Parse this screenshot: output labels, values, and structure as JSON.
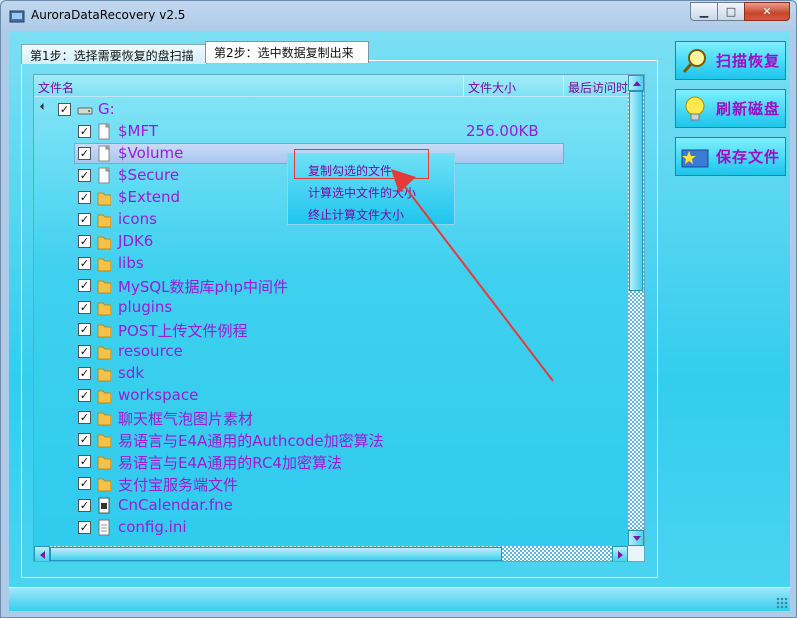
{
  "window": {
    "title": "AuroraDataRecovery v2.5",
    "min_glyph": "▁",
    "max_glyph": "□",
    "close_glyph": "✕"
  },
  "tabs": [
    {
      "label": "第1步：选择需要恢复的盘扫描",
      "active": false
    },
    {
      "label": "第2步：选中数据复制出来",
      "active": true
    }
  ],
  "list": {
    "columns": [
      "文件名",
      "文件大小",
      "最后访问时间"
    ],
    "root": {
      "label": "G:",
      "checked": true,
      "icon": "drive-icon"
    },
    "rows": [
      {
        "name": "$MFT",
        "size": "256.00KB",
        "icon": "file-icon",
        "checked": true
      },
      {
        "name": "$Volume",
        "size": "",
        "icon": "file-icon",
        "checked": true,
        "selected": true
      },
      {
        "name": "$Secure",
        "size": "",
        "icon": "file-icon",
        "checked": true
      },
      {
        "name": "$Extend",
        "size": "",
        "icon": "folder-icon",
        "checked": true
      },
      {
        "name": "icons",
        "size": "",
        "icon": "folder-icon",
        "checked": true
      },
      {
        "name": "JDK6",
        "size": "",
        "icon": "folder-icon",
        "checked": true
      },
      {
        "name": "libs",
        "size": "",
        "icon": "folder-icon",
        "checked": true
      },
      {
        "name": "MySQL数据库php中间件",
        "size": "",
        "icon": "folder-icon",
        "checked": true
      },
      {
        "name": "plugins",
        "size": "",
        "icon": "folder-icon",
        "checked": true
      },
      {
        "name": "POST上传文件例程",
        "size": "",
        "icon": "folder-icon",
        "checked": true
      },
      {
        "name": "resource",
        "size": "",
        "icon": "folder-icon",
        "checked": true
      },
      {
        "name": "sdk",
        "size": "",
        "icon": "folder-icon",
        "checked": true
      },
      {
        "name": "workspace",
        "size": "",
        "icon": "folder-icon",
        "checked": true
      },
      {
        "name": "聊天框气泡图片素材",
        "size": "",
        "icon": "folder-icon",
        "checked": true
      },
      {
        "name": "易语言与E4A通用的Authcode加密算法",
        "size": "",
        "icon": "folder-icon",
        "checked": true
      },
      {
        "name": "易语言与E4A通用的RC4加密算法",
        "size": "",
        "icon": "folder-icon",
        "checked": true
      },
      {
        "name": "支付宝服务端文件",
        "size": "",
        "icon": "folder-icon",
        "checked": true
      },
      {
        "name": "CnCalendar.fne",
        "size": "",
        "icon": "binary-file-icon",
        "checked": true
      },
      {
        "name": "config.ini",
        "size": "",
        "icon": "settings-file-icon",
        "checked": true
      }
    ]
  },
  "context_menu": {
    "items": [
      "复制勾选的文件",
      "计算选中文件的大小",
      "终止计算文件大小"
    ]
  },
  "side_buttons": [
    {
      "label": "扫描恢复",
      "icon": "magnifier-icon"
    },
    {
      "label": "刷新磁盘",
      "icon": "lightbulb-icon"
    },
    {
      "label": "保存文件",
      "icon": "folder-star-icon"
    }
  ],
  "colors": {
    "accent": "#9b1bd6",
    "annotation": "#e63a3a"
  }
}
